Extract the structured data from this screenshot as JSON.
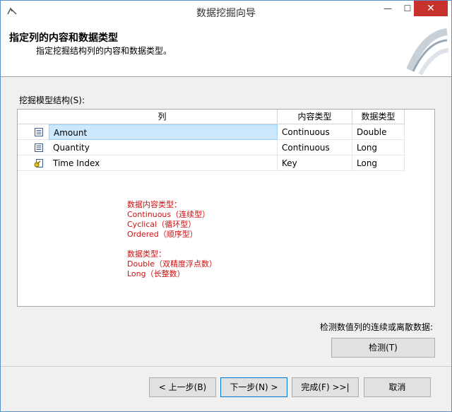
{
  "window": {
    "title": "数据挖掘向导",
    "min_glyph": "—",
    "max_glyph": "☐",
    "close_glyph": "✕"
  },
  "header": {
    "title": "指定列的内容和数据类型",
    "subtitle": "指定挖掘结构列的内容和数据类型。"
  },
  "structure_label": "挖掘模型结构(S):",
  "grid": {
    "columns": [
      "列",
      "内容类型",
      "数据类型"
    ],
    "rows": [
      {
        "icon": "column-icon",
        "column": "Amount",
        "content_type": "Continuous",
        "data_type": "Double",
        "selected": true
      },
      {
        "icon": "column-icon",
        "column": "Quantity",
        "content_type": "Continuous",
        "data_type": "Long",
        "selected": false
      },
      {
        "icon": "key-icon",
        "column": "Time Index",
        "content_type": "Key",
        "data_type": "Long",
        "selected": false
      }
    ]
  },
  "notes": {
    "content_title": "数据内容类型：",
    "content_items": [
      "Continuous（连续型）",
      "Cyclical（循环型）",
      "Ordered（顺序型）"
    ],
    "data_title": "数据类型：",
    "data_items": [
      "Double（双精度浮点数）",
      "Long（长整数）"
    ]
  },
  "detect": {
    "label": "检测数值列的连续或离散数据:",
    "button": "检测(T)"
  },
  "footer": {
    "back": "< 上一步(B)",
    "next": "下一步(N) >",
    "finish": "完成(F) >>|",
    "cancel": "取消"
  },
  "colors": {
    "selection": "#cce8ff",
    "note_red": "#d01010",
    "close_red": "#c7312b"
  }
}
